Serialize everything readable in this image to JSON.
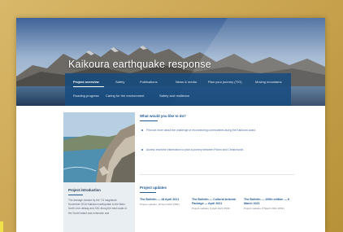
{
  "page": {
    "title": "Kaikoura earthquake response"
  },
  "nav": {
    "items": [
      {
        "label": "Project overview",
        "active": true
      },
      {
        "label": "Safety",
        "active": false
      },
      {
        "label": "Publications",
        "active": false
      },
      {
        "label": "News & media",
        "active": false
      },
      {
        "label": "Plan your journey (TIO)",
        "active": false
      },
      {
        "label": "Moving mountains",
        "active": false
      },
      {
        "label": "Roading progress",
        "active": false
      },
      {
        "label": "Caring for the environment",
        "active": false
      },
      {
        "label": "Safety and resilience",
        "active": false
      }
    ]
  },
  "intro": {
    "title": "Project introduction",
    "text": "The damage caused by the 7.8 magnitude November 2016 Kaikōura earthquake to the Main North Line railway and SH1 along the east coast of the South Island was extensive and"
  },
  "what_to_do": {
    "heading": "What would you like to do?",
    "bullets": [
      "Find out more about the challenge of reconnecting communities along the Kaikōura coast.",
      "Access real time information to plan a journey between Picton and Christchurch."
    ]
  },
  "updates": {
    "heading": "Project updates",
    "items": [
      {
        "title": "The Bulletin — 18 April 2021",
        "meta": "Project updates, 18 April 2021 (PDF)"
      },
      {
        "title": "The Bulletin — Cultural Artwork Package — April 2021",
        "meta": "Project updates, 9 April 2021 (PDF)"
      },
      {
        "title": "The Bulletin — 100th edition — 8 March 2021",
        "meta": "Project updates, 8 March 2021 (PDF)"
      }
    ]
  },
  "colors": {
    "nav_bg": "#184c80",
    "link": "#1f5a94",
    "frame": "#c8a24d"
  }
}
